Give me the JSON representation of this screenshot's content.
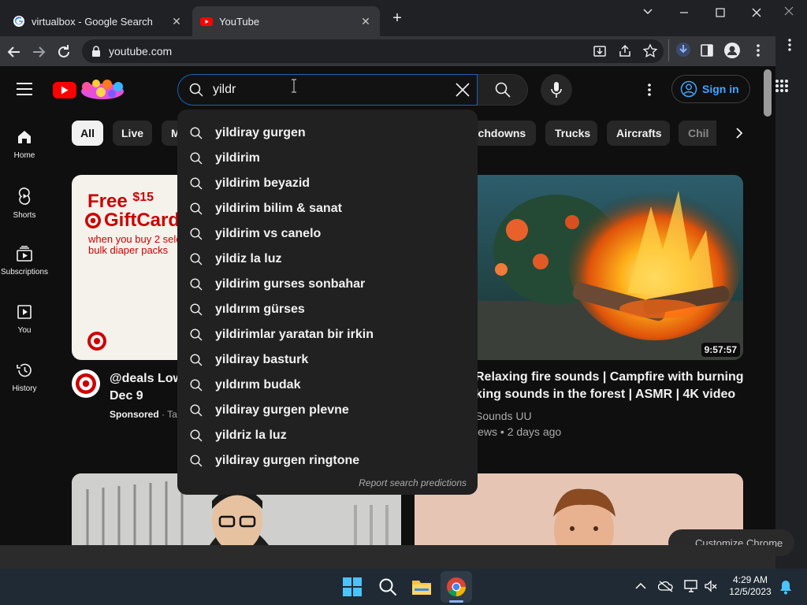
{
  "browser": {
    "tabs": [
      {
        "title": "virtualbox - Google Search",
        "favicon": "google-icon"
      },
      {
        "title": "YouTube",
        "favicon": "youtube-icon"
      }
    ],
    "url": "youtube.com"
  },
  "youtube": {
    "search_value": "yildr",
    "sign_in_label": "Sign in",
    "sidebar": [
      {
        "label": "Home",
        "icon": "home-icon"
      },
      {
        "label": "Shorts",
        "icon": "shorts-icon"
      },
      {
        "label": "Subscriptions",
        "icon": "subscriptions-icon"
      },
      {
        "label": "You",
        "icon": "you-icon"
      },
      {
        "label": "History",
        "icon": "history-icon"
      }
    ],
    "chips": [
      "All",
      "Live",
      "M",
      "uchdowns",
      "Trucks",
      "Aircrafts",
      "Chil"
    ],
    "suggestions": [
      "yildiray gurgen",
      "yildirim",
      "yildirim beyazid",
      "yildirim bilim & sanat",
      "yildirim vs canelo",
      "yildiz la luz",
      "yildirim gurses sonbahar",
      "yıldırım gürses",
      "yildirimlar yaratan bir irkin",
      "yildiray basturk",
      "yıldırım budak",
      "yildiray gurgen plevne",
      "yildriz la luz",
      "yildiray gurgen ringtone"
    ],
    "report_label": "Report search predictions",
    "ad": {
      "free_line": "Free",
      "amount": "$15",
      "giftcard": "GiftCard",
      "subline1": "when you buy 2 sele",
      "subline2": "bulk diaper packs",
      "title_line1": "@deals Low",
      "title_line2": "Dec 9",
      "sponsored": "Sponsored",
      "sponsored_suffix": " · Ta"
    },
    "video": {
      "duration": "9:57:57",
      "title_line1": "Relaxing fire sounds | Campfire with burning",
      "title_line2": "king sounds in the forest | ASMR | 4K video",
      "channel": "Sounds UU",
      "meta": "iews • 2 days ago"
    },
    "customize_label": "Customize Chrome"
  },
  "taskbar": {
    "time": "4:29 AM",
    "date": "12/5/2023"
  },
  "colors": {
    "accent": "#3ea6ff",
    "youtube_red": "#ff0000",
    "target_red": "#cc0000"
  }
}
